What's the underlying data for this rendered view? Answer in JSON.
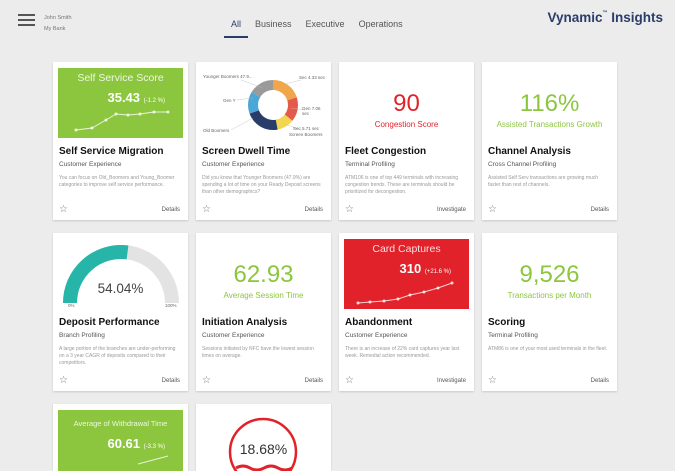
{
  "header": {
    "user_name": "John Smith",
    "bank_name": "My Bank",
    "tabs": [
      {
        "label": "All",
        "active": true
      },
      {
        "label": "Business",
        "active": false
      },
      {
        "label": "Executive",
        "active": false
      },
      {
        "label": "Operations",
        "active": false
      }
    ],
    "brand": "Vynamic",
    "brand_tm": "™",
    "brand_suffix": " Insights"
  },
  "colors": {
    "green": "#8cc63f",
    "red": "#e2222a",
    "teal": "#26b5a8",
    "navy": "#2a3d6a"
  },
  "cards": [
    {
      "hero_title": "Self Service Score",
      "hero_value": "35.43",
      "hero_change": "(-1.2 %)",
      "title": "Self Service Migration",
      "subtitle": "Customer Experience",
      "description": "You can focus on Old_Boomers and Young_Boomer categories to improve self service performance.",
      "action": "Details"
    },
    {
      "title": "Screen Dwell Time",
      "subtitle": "Customer Experience",
      "description": "Did you know that Younger Boomers (47.9%) are spending a lot of time on your Ready Deposit screens than other demographics?",
      "donut_labels": [
        "Younger Boomers 47.9...",
        "Sec 4.33 sec",
        "Gen 7.06 sec",
        "Old Boomers",
        "Sec 5.71 sec",
        "Screen Boomers",
        "Gen Y"
      ],
      "action": "Details"
    },
    {
      "big_value": "90",
      "big_label": "Congestion Score",
      "title": "Fleet Congestion",
      "subtitle": "Terminal Profiling",
      "description": "ATM106 is one of top 449 terminals with increasing congestion trends. These are terminals should be prioritized for decongestion.",
      "action": "Investigate"
    },
    {
      "big_value": "116%",
      "big_label": "Assisted Transactions Growth",
      "title": "Channel Analysis",
      "subtitle": "Cross Channel Profiling",
      "description": "Assisted Self Serv transactions are growing much faster than rest of channels.",
      "action": "Details"
    },
    {
      "gauge_value": "54.04%",
      "gauge_fraction": 0.5404,
      "gauge_min": "0%",
      "gauge_max": "100%",
      "title": "Deposit Performance",
      "subtitle": "Branch Profiling",
      "description": "A large portion of the branches are under-performing on a 3 year CAGR of deposits compared to their competitors.",
      "action": "Details"
    },
    {
      "big_value": "62.93",
      "big_label": "Average Session Time",
      "title": "Initiation Analysis",
      "subtitle": "Customer Experience",
      "description": "Sessions initiated by NFC have the lowest session times on average.",
      "action": "Details"
    },
    {
      "hero_title": "Card Captures",
      "hero_value": "310",
      "hero_change": "(+21.6 %)",
      "title": "Abandonment",
      "subtitle": "Customer Experience",
      "description": "There is an increase of 22% card captures year last week. Remedial action recommended.",
      "action": "Investigate"
    },
    {
      "big_value": "9,526",
      "big_label": "Transactions per Month",
      "title": "Scoring",
      "subtitle": "Terminal Profiling",
      "description": "ATM86 is one of your most used terminals in the fleet.",
      "action": "Details"
    },
    {
      "hero_title": "Average of Withdrawal Time",
      "hero_value": "60.61",
      "hero_change": "(-3.3 %)"
    },
    {
      "big_value": "18.68%"
    }
  ]
}
